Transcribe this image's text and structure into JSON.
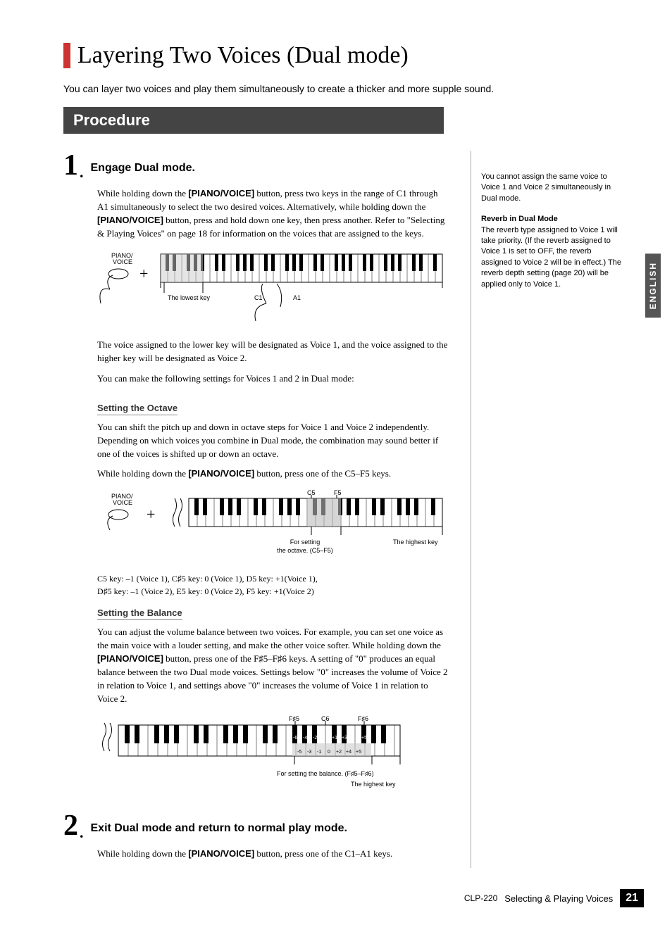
{
  "title": "Layering Two Voices (Dual mode)",
  "intro": "You can layer two voices and play them simultaneously to create a thicker and more supple sound.",
  "procedure_label": "Procedure",
  "step1": {
    "num": "1",
    "dot": ".",
    "title": "Engage Dual mode.",
    "body_pre": "While holding down the ",
    "body_btn": "[PIANO/VOICE]",
    "body_post": " button, press two keys in the range of C1 through A1 simultaneously to select the two desired voices. Alternatively, while holding down the ",
    "body_btn2": "[PIANO/VOICE]",
    "body_post2": " button, press and hold down one key, then press another. Refer to \"Selecting & Playing Voices\" on page 18 for information on the voices that are assigned to the keys.",
    "diag1": {
      "piano_voice": "PIANO/\nVOICE",
      "plus": "+",
      "lowest": "The lowest key",
      "c1": "C1",
      "a1": "A1"
    },
    "voice_note": "The voice assigned to the lower key will be designated as Voice 1, and the voice assigned to the higher key will be designated as Voice 2.",
    "settings_intro": "You can make the following settings for Voices 1 and 2 in Dual mode:"
  },
  "octave": {
    "heading": "Setting the Octave",
    "body": "You can shift the pitch up and down in octave steps for Voice 1 and Voice 2 independently. Depending on which voices you combine in Dual mode, the combination may sound better if one of the voices is shifted up or down an octave.",
    "instr_pre": "While holding down the ",
    "instr_btn": "[PIANO/VOICE]",
    "instr_post": " button, press one of the C5–F5 keys.",
    "diag": {
      "piano_voice": "PIANO/\nVOICE",
      "plus": "+",
      "c5": "C5",
      "f5": "F5",
      "highest": "The highest key",
      "setting_caption": "For setting\nthe octave. (C5–F5)"
    },
    "legend_line1": "C5 key: –1 (Voice 1),   C♯5 key: 0 (Voice 1),  D5 key: +1(Voice 1),",
    "legend_line2": "D♯5 key: –1 (Voice 2),  E5 key: 0 (Voice 2),   F5 key: +1(Voice 2)"
  },
  "balance": {
    "heading": "Setting the Balance",
    "body_pre": "You can adjust the volume balance between two voices. For example, you can set one voice as the main voice with a louder setting, and make the other voice softer. While holding down the ",
    "body_btn": "[PIANO/VOICE]",
    "body_post": " button, press one of the F♯5–F♯6 keys. A setting of \"0\" produces an equal balance between the two Dual mode voices. Settings below \"0\" increases the volume of Voice 2 in relation to Voice 1, and settings above \"0\" increases the volume of Voice 1 in relation to Voice 2.",
    "diag": {
      "f_sharp_5": "F♯5",
      "c6": "C6",
      "f_sharp_6": "F♯6",
      "black_vals": [
        "-6",
        "-4",
        "-2",
        "+1",
        "+3",
        "+5"
      ],
      "white_vals": [
        "-5",
        "-3",
        "-1",
        "0",
        "+2",
        "+4",
        "+5"
      ],
      "caption": "For setting the balance. (F♯5–F♯6)",
      "highest": "The highest key"
    }
  },
  "step2": {
    "num": "2",
    "dot": ".",
    "title": "Exit Dual mode and return to normal play mode.",
    "body_pre": "While holding down the ",
    "body_btn": "[PIANO/VOICE]",
    "body_post": " button, press one of the C1–A1 keys."
  },
  "side": {
    "note1": "You cannot assign the same voice to Voice 1 and Voice 2 simultaneously in Dual mode.",
    "reverb_title": "Reverb in Dual Mode",
    "reverb_body": "The reverb type assigned to Voice 1 will take priority. (If the reverb assigned to Voice 1 is set to OFF, the reverb assigned to Voice 2 will be in effect.) The reverb depth setting (page 20) will be applied only to Voice 1."
  },
  "tab": "ENGLISH",
  "footer": {
    "model": "CLP-220",
    "section": "Selecting & Playing Voices",
    "page": "21"
  }
}
